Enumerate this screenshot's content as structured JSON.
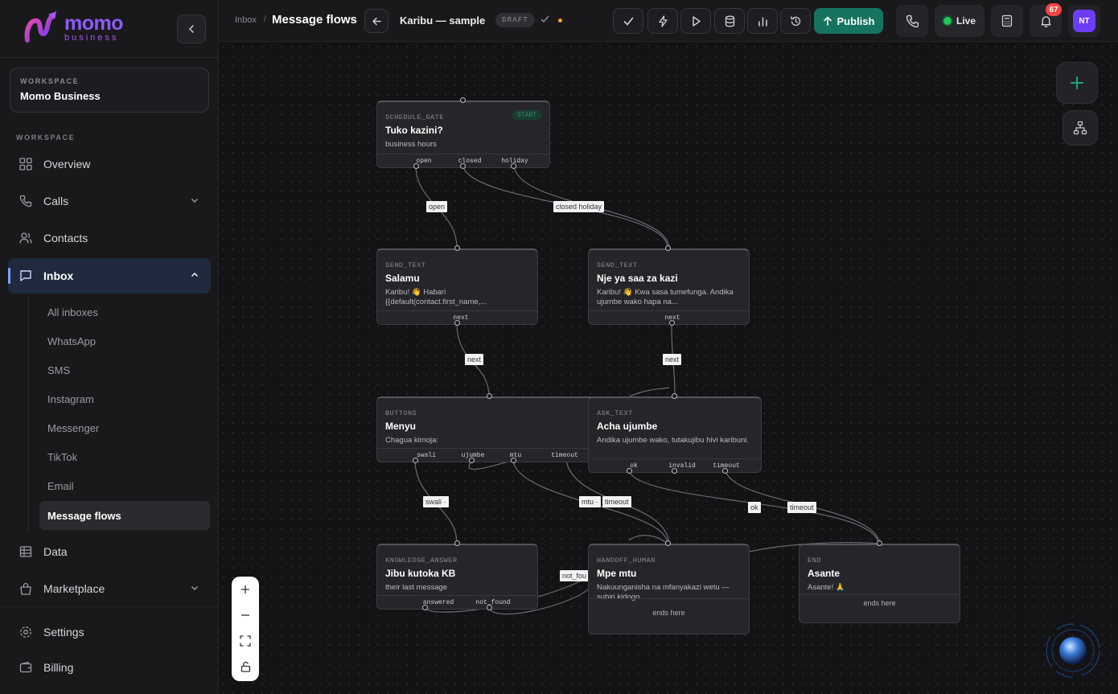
{
  "brand": {
    "name": "momo",
    "sub": "business"
  },
  "workspace_card": {
    "label": "WORKSPACE",
    "value": "Momo Business"
  },
  "section_label": "WORKSPACE",
  "nav": {
    "overview": "Overview",
    "calls": "Calls",
    "contacts": "Contacts",
    "inbox": "Inbox",
    "data": "Data",
    "marketplace": "Marketplace",
    "settings": "Settings",
    "billing": "Billing"
  },
  "inbox_sub": [
    "All inboxes",
    "WhatsApp",
    "SMS",
    "Instagram",
    "Messenger",
    "TikTok",
    "Email",
    "Message flows"
  ],
  "topbar": {
    "breadcrumb": "Inbox",
    "separator": "/",
    "title": "Message flows",
    "flow_name": "Karibu — sample",
    "draft": "DRAFT",
    "publish": "Publish",
    "live": "Live",
    "notifications": "67",
    "avatar": "NT"
  },
  "nodes": {
    "schedule": {
      "type": "SCHEDULE_GATE",
      "badge": "START",
      "title": "Tuko kazini?",
      "body": "business hours",
      "ports": [
        "open",
        "closed",
        "holiday"
      ]
    },
    "salamu": {
      "type": "SEND_TEXT",
      "title": "Salamu",
      "body": "Karibu! 👋 Habari {{default(contact.first_name,...",
      "ports": [
        "next"
      ]
    },
    "nje": {
      "type": "SEND_TEXT",
      "title": "Nje ya saa za kazi",
      "body": "Karibu! 👋 Kwa sasa tumefunga. Andika ujumbe wako hapa na...",
      "ports": [
        "next"
      ]
    },
    "menyu": {
      "type": "BUTTONS",
      "title": "Menyu",
      "body": "Chagua kimoja:",
      "ports": [
        "swali",
        "ujumbe",
        "mtu",
        "timeout"
      ]
    },
    "acha": {
      "type": "ASK_TEXT",
      "title": "Acha ujumbe",
      "body": "Andika ujumbe wako, tutakujibu hivi karibuni.",
      "ports": [
        "ok",
        "invalid",
        "timeout"
      ]
    },
    "jibu": {
      "type": "KNOWLEDGE_ANSWER",
      "title": "Jibu kutoka KB",
      "body": "their last message",
      "ports": [
        "answered",
        "not_found"
      ]
    },
    "mpe": {
      "type": "HANDOFF_HUMAN",
      "title": "Mpe mtu",
      "body": "Nakuunganisha na mfanyakazi wetu — subiri kidogo.",
      "footer": "ends here"
    },
    "asante": {
      "type": "END",
      "title": "Asante",
      "body": "Asante! 🙏",
      "footer": "ends here"
    }
  },
  "edge_labels": {
    "open": "open",
    "closed_holiday": "closed holiday",
    "next1": "next",
    "next2": "next",
    "swali": "swali ·",
    "mtu": "mtu ·",
    "timeout1": "timeout",
    "ok": "ok",
    "timeout2": "timeout",
    "not_found": "not_fou"
  },
  "colors": {
    "accent": "#16735f",
    "active_nav": "#1f2a3f",
    "notif": "#ef4444",
    "avatar": "#6d3cf6",
    "live": "#22c55e"
  }
}
